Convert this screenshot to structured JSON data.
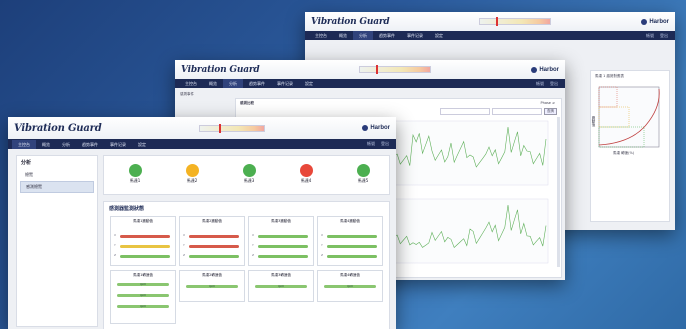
{
  "app": {
    "logo": "Vibration Guard",
    "brand": "Harbor",
    "brand_icon": "harbor-logo-icon",
    "accent_nav": "#1d2a55",
    "nav": [
      "主控台",
      "概览",
      "分析",
      "趋势事件",
      "事件记录",
      "設定"
    ],
    "user": [
      "帳號",
      "登出"
    ]
  },
  "front": {
    "sidebar_title": "分析",
    "sidebar_items": [
      "總覽",
      "感測總覽"
    ],
    "lamps": [
      {
        "label": "馬達1",
        "color": "#4caf50"
      },
      {
        "label": "馬達2",
        "color": "#f4b323"
      },
      {
        "label": "馬達3",
        "color": "#4caf50"
      },
      {
        "label": "馬達4",
        "color": "#e8483a"
      },
      {
        "label": "馬達5",
        "color": "#4caf50"
      }
    ],
    "section_title": "感測器監測狀態",
    "panels_row1": [
      "馬達1震動值",
      "馬達2震動值",
      "馬達3震動值",
      "馬達4震動值"
    ],
    "panels_row2": [
      "馬達1轉速值",
      "馬達2轉速值",
      "馬達3轉速值",
      "馬達4轉速值"
    ],
    "axis_labels": [
      "X",
      "Y",
      "Z"
    ],
    "rpm_label": "rpm"
  },
  "middle": {
    "sidebar_item": "感測事件",
    "panel_title": "感測比較",
    "legend": "Phase ≥",
    "toolbar_btn": "查詢"
  },
  "back": {
    "chart_title": "馬達 1 趨勢對應表",
    "ylabel": "震動值",
    "xlabel": "馬達 轉速(%)"
  },
  "chart_data": {
    "type": "line",
    "title": "",
    "series": [
      {
        "values": [
          3,
          6,
          4,
          8,
          5,
          9,
          4,
          7,
          5,
          10,
          6,
          8,
          5,
          7,
          12,
          6,
          9
        ]
      },
      {
        "values": [
          2,
          5,
          3,
          6,
          4,
          3,
          8,
          4,
          5,
          3,
          6,
          4,
          7,
          9,
          14,
          5,
          8
        ]
      }
    ]
  }
}
